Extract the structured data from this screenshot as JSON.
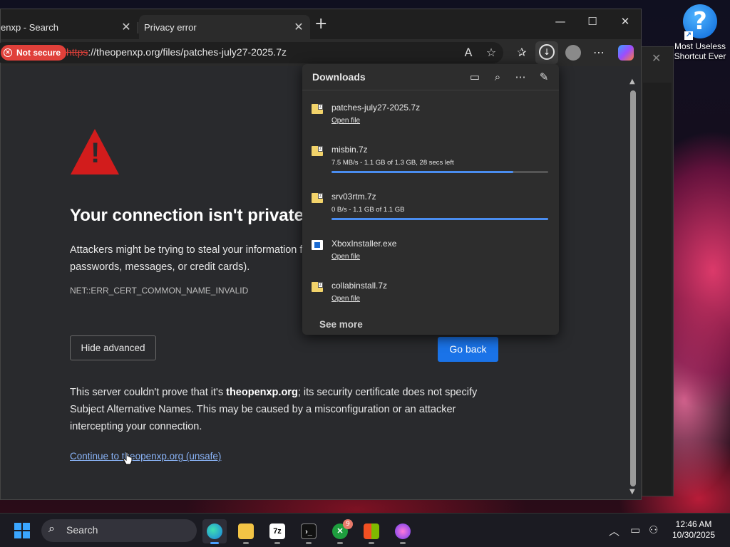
{
  "desktop": {
    "icon_label": "Most Useless Shortcut Ever",
    "icon_glyph": "?"
  },
  "browser": {
    "tabs": [
      {
        "label": "enxp - Search",
        "close": "✕"
      },
      {
        "label": "Privacy error",
        "close": "✕"
      }
    ],
    "new_tab": "+",
    "window_controls": {
      "minimize": "—",
      "maximize": "☐",
      "close": "✕"
    },
    "address_bar": {
      "security_badge": "Not secure",
      "url_scheme": "https",
      "url_rest": "://theopenxp.org/files/patches-july27-2025.7z"
    },
    "toolbar_icons": [
      "read-aloud-icon",
      "favorite-star-icon",
      "favorites-icon",
      "downloads-icon",
      "profile-icon",
      "more-icon",
      "copilot-icon"
    ]
  },
  "page": {
    "title": "Your connection isn't private",
    "intro_line1": "Attackers might be trying to steal your information fr",
    "intro_line2": "passwords, messages, or credit cards).",
    "error_code": "NET::ERR_CERT_COMMON_NAME_INVALID",
    "hide_advanced": "Hide advanced",
    "go_back": "Go back",
    "detail_pre": "This server couldn't prove that it's ",
    "detail_domain": "theopenxp.org",
    "detail_post": "; its security certificate does not specify Subject Alternative Names. This may be caused by a misconfiguration or an attacker intercepting your connection.",
    "continue_link": "Continue to theopenxp.org (unsafe)"
  },
  "downloads": {
    "title": "Downloads",
    "items": [
      {
        "name": "patches-july27-2025.7z",
        "action": "Open file"
      },
      {
        "name": "misbin.7z",
        "status": "7.5 MB/s - 1.1 GB of 1.3 GB, 28 secs left",
        "progress": 0.84
      },
      {
        "name": "srv03rtm.7z",
        "status": "0 B/s - 1.1 GB of 1.1 GB",
        "progress": 1.0
      },
      {
        "name": "XboxInstaller.exe",
        "action": "Open file"
      },
      {
        "name": "collabinstall.7z",
        "action": "Open file"
      }
    ],
    "see_more": "See more"
  },
  "taskbar": {
    "search_label": "Search",
    "apps": [
      "edge",
      "file-explorer",
      "7zip",
      "terminal",
      "xbox",
      "store",
      "paint"
    ],
    "xbox_badge": "9",
    "time": "12:46 AM",
    "date": "10/30/2025"
  }
}
